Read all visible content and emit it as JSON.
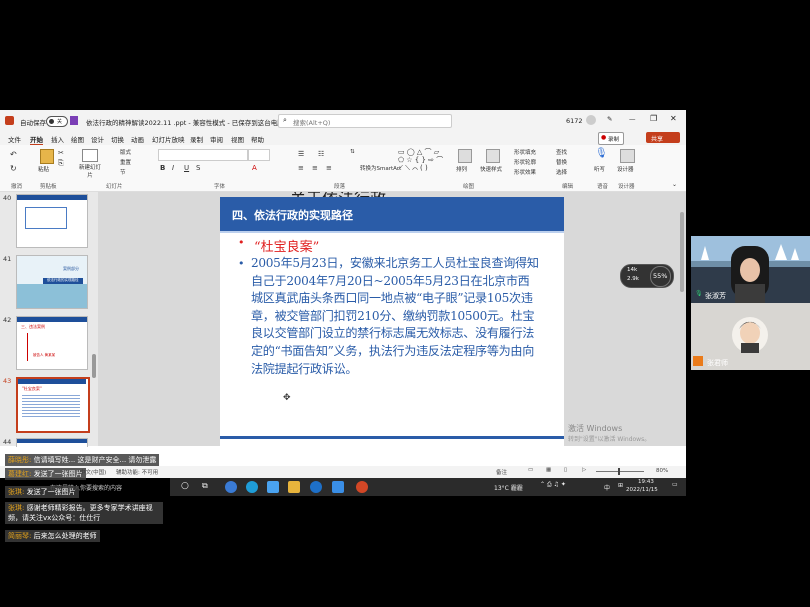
{
  "ppt": {
    "autosave": "自动保存",
    "autosave_state": "关",
    "doc_title": "依法行政的精神解读2022.11 .ppt - 兼容性模式 - 已保存到这台电脑",
    "search_placeholder": "搜索(Alt+Q)",
    "user_num": "6172",
    "menu": [
      "文件",
      "开始",
      "插入",
      "绘图",
      "设计",
      "切换",
      "动画",
      "幻灯片放映",
      "录制",
      "审阅",
      "视图",
      "帮助"
    ],
    "record_btn": "录制",
    "share_btn": "共享",
    "ribbon": {
      "paste": "粘贴",
      "new_slide": "新建幻灯片",
      "layout": "版式",
      "reset": "重置",
      "section": "节",
      "convert_smartart": "转换为SmartArt",
      "arrange": "排列",
      "quick_styles": "快速样式",
      "shape_fill": "形状填充",
      "shape_outline": "形状轮廓",
      "shape_effect": "形状效果",
      "find": "查找",
      "replace": "替换",
      "select": "选择",
      "dictate": "听写",
      "designer": "设计器",
      "groups": [
        "撤消",
        "剪贴板",
        "幻灯片",
        "字体",
        "段落",
        "绘图",
        "编辑",
        "语音",
        "设计器"
      ]
    },
    "thumbs": [
      {
        "num": "40",
        "title": "",
        "text": ""
      },
      {
        "num": "41",
        "title": "案例部分",
        "text": "依法行政的实现路径"
      },
      {
        "num": "42",
        "title": "三、违法案例",
        "text": "被告人 黄某某"
      },
      {
        "num": "43",
        "title": "\"杜宝良案\"",
        "text": ""
      },
      {
        "num": "44",
        "title": "",
        "text": ""
      }
    ],
    "slide": {
      "partial_title": "关于依法行政...",
      "header": "四、依法行政的实现路径",
      "bullet1": "“杜宝良案”",
      "bullet2": "2005年5月23日，安徽来北京务工人员杜宝良查询得知自己于2004年7月20日~2005年5月23日在北京市西城区真武庙头条西口同一地点被“电子眼”记录105次违章，被交管部门扣罚210分、缴纳罚款10500元。杜宝良以交管部门设立的禁行标志属无效标志、没有履行法定的“书面告知”义务，执法行为违反法定程序等为由向法院提起行政诉讼。"
    },
    "watermark_line1": "激活 Windows",
    "watermark_line2": "转到\"设置\"以激活 Windows。",
    "status": {
      "lang": "中文(中国)",
      "accessibility": "辅助功能: 不可用",
      "notes": "备注",
      "zoom": "80%"
    }
  },
  "taskbar": {
    "weather": "13°C 霾霾",
    "ime": "中",
    "time": "19:43",
    "date": "2022/11/15",
    "search_text": "在这里输入你要搜索的内容"
  },
  "network_widget": {
    "up": "14k",
    "down": "2.9k",
    "percent": "55%"
  },
  "video": {
    "person1": "张淑芳",
    "person2": "张君师"
  },
  "chat": [
    {
      "user": "薛晓彤:",
      "text": "信请填写姓... 这是财产安全... 请勿泄露"
    },
    {
      "user": "葛建红:",
      "text": "发送了一张图片"
    },
    {
      "user": "张琪:",
      "text": "发送了一张图片"
    },
    {
      "user": "张琪:",
      "text": "感谢老师精彩报告。更多专家学术讲座视"
    },
    {
      "user": "",
      "text": "频，请关注vx公众号：仕仕行"
    },
    {
      "user": "简丽琴:",
      "text": "后来怎么处理的老师"
    }
  ]
}
